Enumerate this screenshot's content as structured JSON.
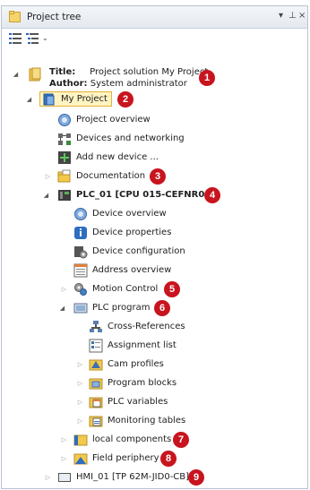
{
  "panel": {
    "title": "Project tree",
    "controls": [
      "▾",
      "⊥",
      "×"
    ]
  },
  "project": {
    "title_label": "Title:",
    "title_value": "Project solution My Project",
    "author_label": "Author:",
    "author_value": "System administrator",
    "marker": "1"
  },
  "tree": {
    "my_project": {
      "label": "My Project",
      "marker": "2"
    },
    "project_overview": "Project overview",
    "devices_networking": "Devices and networking",
    "add_device": "Add new device ...",
    "documentation": {
      "label": "Documentation",
      "marker": "3"
    },
    "plc": {
      "label": "PLC_01 [CPU 015-CEFNR00]",
      "marker": "4"
    },
    "device_overview": "Device overview",
    "device_properties": "Device properties",
    "device_configuration": "Device configuration",
    "address_overview": "Address overview",
    "motion_control": {
      "label": "Motion Control",
      "marker": "5"
    },
    "plc_program": {
      "label": "PLC program",
      "marker": "6"
    },
    "cross_references": "Cross-References",
    "assignment_list": "Assignment list",
    "cam_profiles": "Cam profiles",
    "program_blocks": "Program blocks",
    "plc_variables": "PLC variables",
    "monitoring_tables": "Monitoring tables",
    "local_components": {
      "label": "local components",
      "marker": "7"
    },
    "field_periphery": {
      "label": "Field periphery",
      "marker": "8"
    },
    "hmi": {
      "label": "HMI_01 [TP 62M-JID0-CB]",
      "marker": "9"
    }
  },
  "colors": {
    "marker": "#c8141e",
    "selection_bg": "#fff4c2",
    "selection_border": "#e2b33a",
    "folder": "#f2c94c"
  }
}
